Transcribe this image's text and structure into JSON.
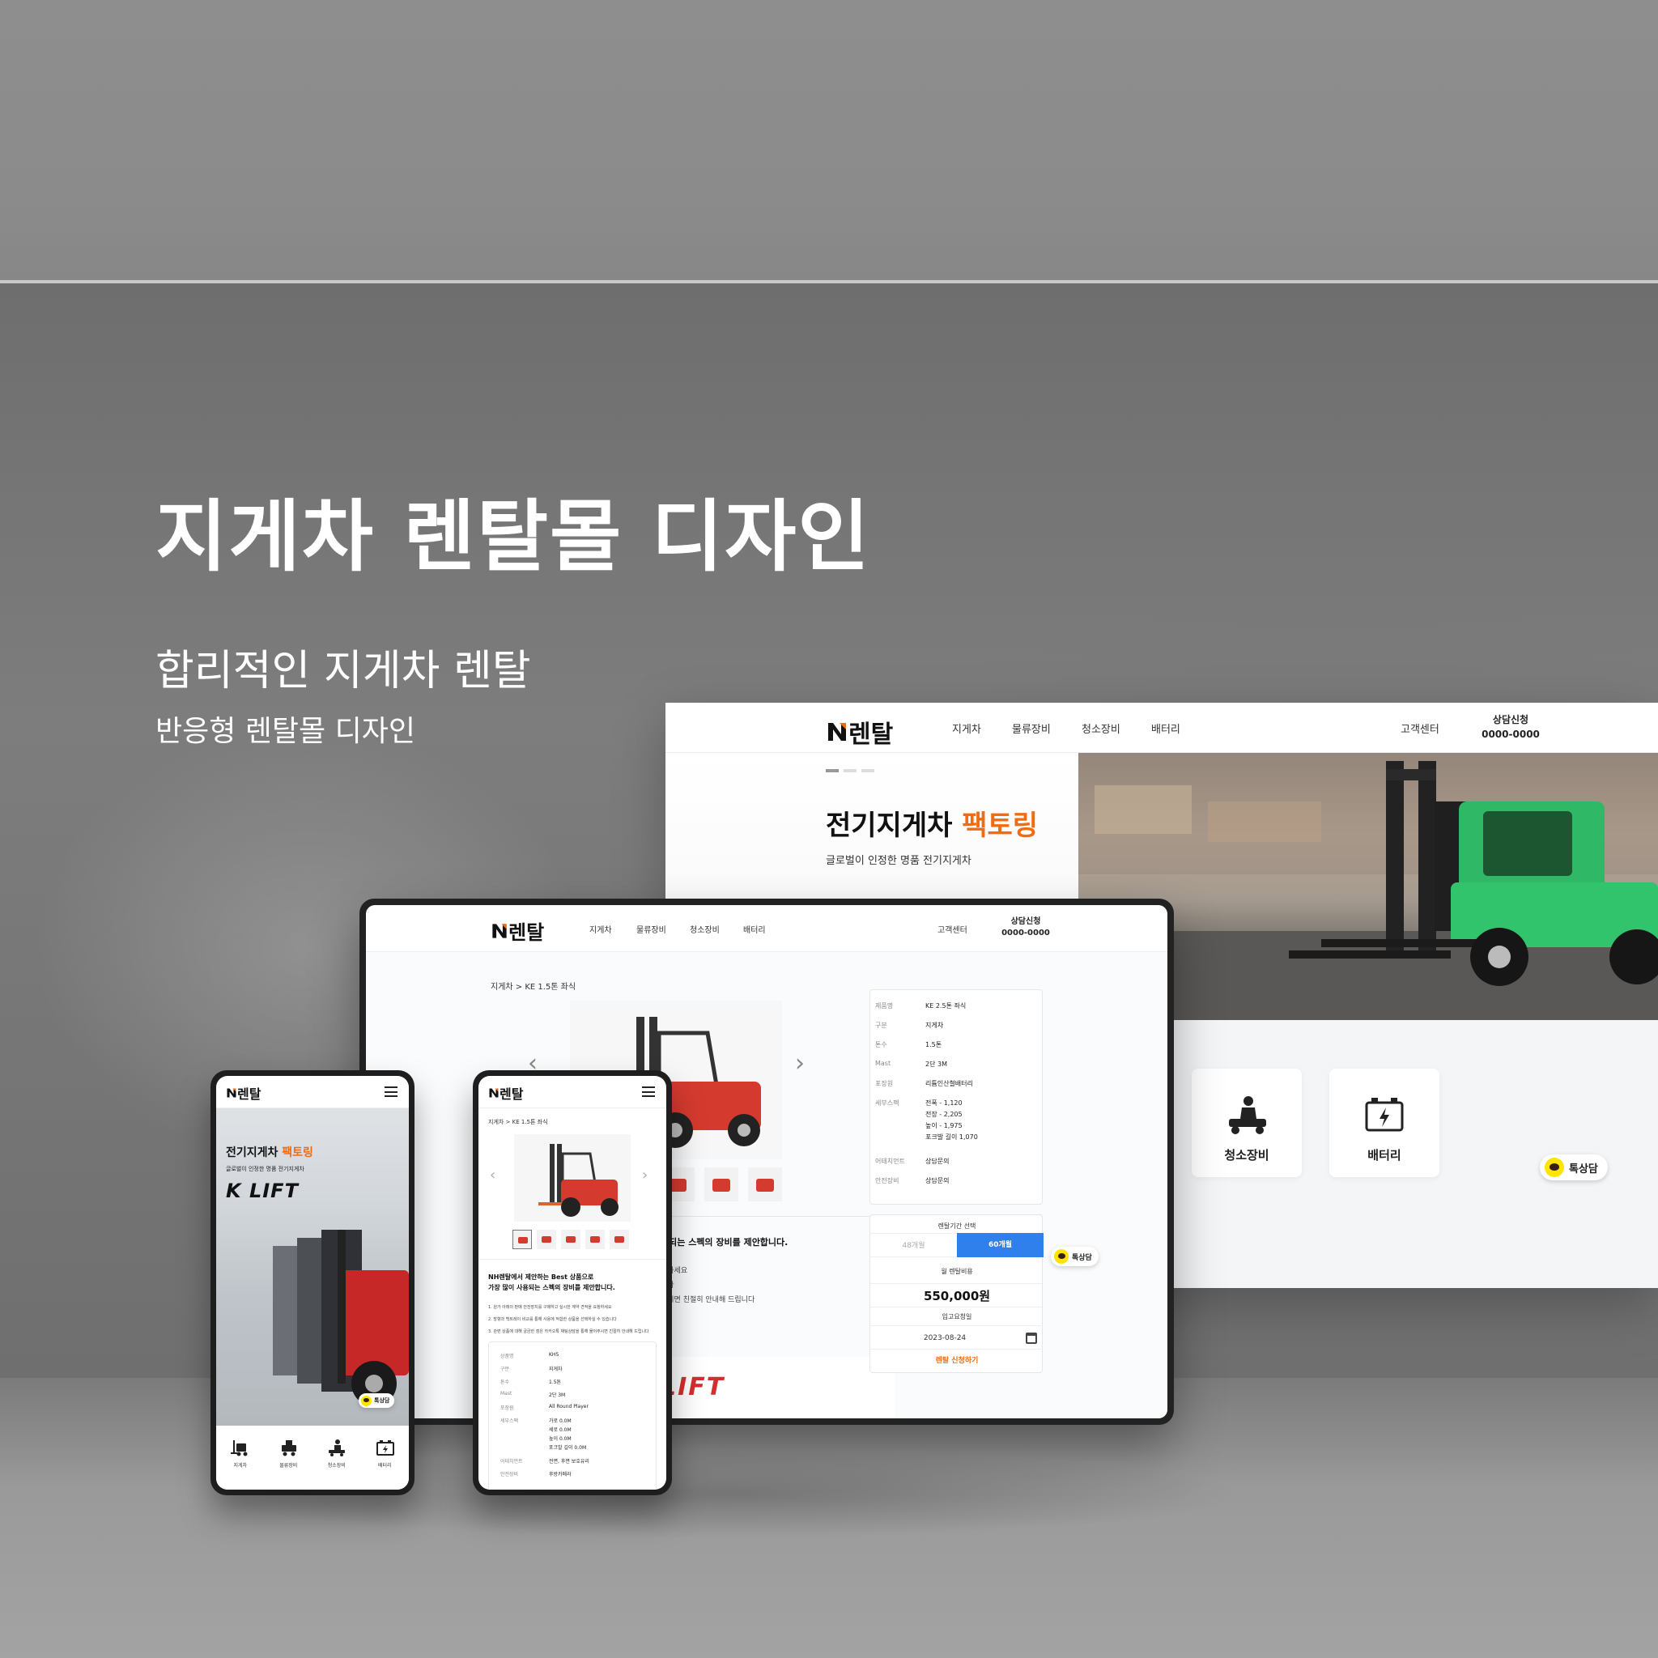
{
  "hero": {
    "title": "지게차 렌탈몰 디자인",
    "subtitle": "합리적인 지게차 렌탈",
    "subtitle2": "반응형 렌탈몰 디자인"
  },
  "brand": {
    "logo_mark": "N",
    "logo_text": "렌탈",
    "accent": "#f26b0f",
    "blue": "#2f80ed",
    "kakao": "#fde500"
  },
  "desktop": {
    "nav": [
      "지게차",
      "물류장비",
      "청소장비",
      "배터리"
    ],
    "customer_center": "고객센터",
    "call_label": "상담신청",
    "call_number": "0000-0000",
    "headline_main": "전기지게차",
    "headline_accent": "팩토링",
    "headline_sub": "글로벌이 인정한 명품 전기지게차",
    "categories": [
      {
        "label": "청소장비",
        "icon": "cleaning-machine-icon"
      },
      {
        "label": "배터리",
        "icon": "battery-icon"
      }
    ],
    "kakao_label": "톡상담"
  },
  "tablet": {
    "nav": [
      "지게차",
      "물류장비",
      "청소장비",
      "배터리"
    ],
    "customer_center": "고객센터",
    "call_label": "상담신청",
    "call_number": "0000-0000",
    "breadcrumb": "지게차 > KE 1.5톤 좌식",
    "desc_heading": "용되는 스펙의 장비를 제안합니다.",
    "desc_lines": [
      "청하세요",
      "니다",
      "주시면 친절히 안내해 드립니다"
    ],
    "brand_strip": "LIFT",
    "specs": [
      {
        "k": "제품명",
        "v": "KE 2.5톤 좌식"
      },
      {
        "k": "구분",
        "v": "지게차"
      },
      {
        "k": "톤수",
        "v": "1.5톤"
      },
      {
        "k": "Mast",
        "v": "2단 3M"
      },
      {
        "k": "포장원",
        "v": "리튬인산철배터리"
      },
      {
        "k": "세부스펙",
        "v": "전폭 - 1,120"
      },
      {
        "k": "",
        "v": "전장 - 2,205"
      },
      {
        "k": "",
        "v": "높이 - 1,975"
      },
      {
        "k": "",
        "v": "포크발 길이 1,070"
      },
      {
        "k": "어태치먼트",
        "v": "상담문의"
      },
      {
        "k": "안전장비",
        "v": "상담문의"
      }
    ],
    "rent_period_label": "렌탈기간 선택",
    "period_off": "48개월",
    "period_on": "60개월",
    "monthly_label": "월 렌탈비용",
    "monthly_price": "550,000원",
    "ship_label": "입고요청일",
    "ship_date": "2023-08-24",
    "apply_label": "렌탈 신청하기",
    "kakao_label": "톡상담"
  },
  "phone1": {
    "headline_main": "전기지게차",
    "headline_accent": "팩토링",
    "headline_sub": "글로벌이 인정한 명품 전기지게차",
    "brand": "K LIFT",
    "kakao_label": "톡상담",
    "categories": [
      "지게차",
      "물류장비",
      "청소장비",
      "배터리"
    ]
  },
  "phone2": {
    "breadcrumb": "지게차 > KE 1.5톤 좌식",
    "heading1": "NH렌탈에서 제안하는 Best 상품으로",
    "heading2": "가장 많이 사용되는 스펙의 장비를 제안합니다.",
    "notes": [
      "1. 원가 아래의 판매 안전장치를 구매하고 실시한 계약 견적을 요청하세요",
      "2. 방향과 백트레이 비교를 통해 사용에 적합한 상품을 선택하실 수 있습니다",
      "3. 관련 상품에 대해 궁금한 점은 카카오톡 채팅상담을 통해 물어주시면 친절히 안내해 드립니다"
    ],
    "specs": [
      {
        "k": "상품명",
        "v": "KH5"
      },
      {
        "k": "구분",
        "v": "지게차"
      },
      {
        "k": "톤수",
        "v": "1.5톤"
      },
      {
        "k": "Mast",
        "v": "2단 3M"
      },
      {
        "k": "포장원",
        "v": "All Round Player"
      },
      {
        "k": "세부스펙",
        "v": "가로 0.0M"
      },
      {
        "k": "",
        "v": "세로 0.0M"
      },
      {
        "k": "",
        "v": "높이 0.0M"
      },
      {
        "k": "",
        "v": "포크발 길이 0.0M"
      },
      {
        "k": "어태치먼트",
        "v": "전면, 후면 보호유리"
      },
      {
        "k": "안전장비",
        "v": "후방카메라"
      }
    ]
  }
}
